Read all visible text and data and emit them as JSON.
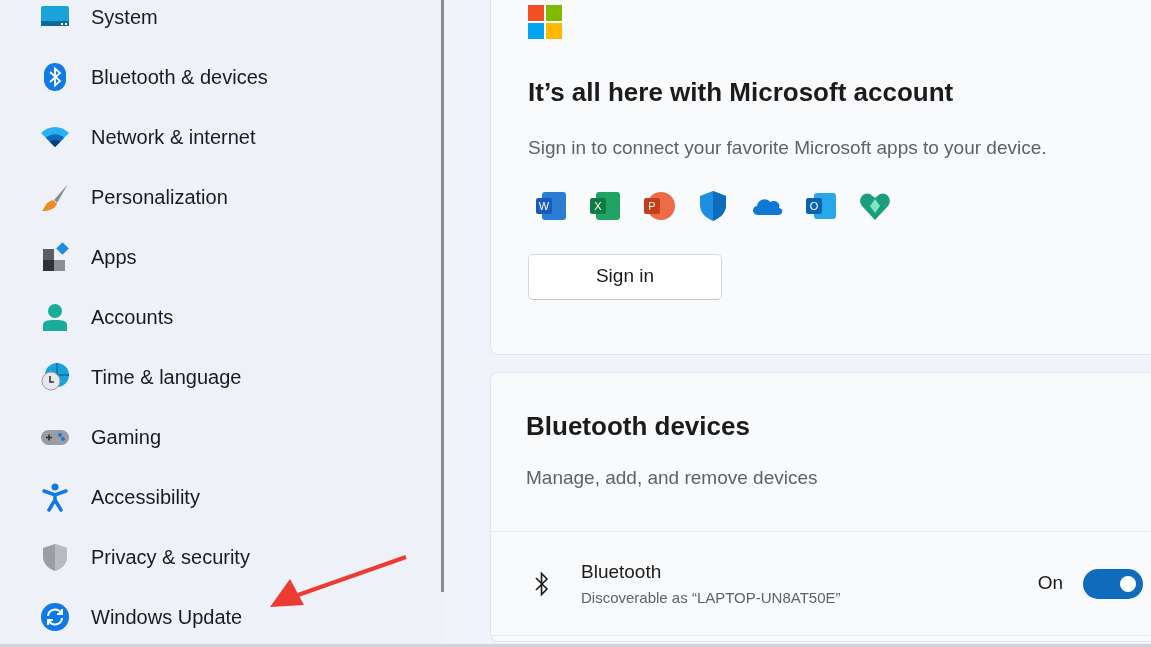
{
  "sidebar": {
    "items": [
      {
        "label": "System"
      },
      {
        "label": "Bluetooth & devices"
      },
      {
        "label": "Network & internet"
      },
      {
        "label": "Personalization"
      },
      {
        "label": "Apps"
      },
      {
        "label": "Accounts"
      },
      {
        "label": "Time & language"
      },
      {
        "label": "Gaming"
      },
      {
        "label": "Accessibility"
      },
      {
        "label": "Privacy & security"
      },
      {
        "label": "Windows Update"
      }
    ]
  },
  "account_card": {
    "title": "It’s all here with Microsoft account",
    "subtitle": "Sign in to connect your favorite Microsoft apps to your device.",
    "app_icons": [
      {
        "kind": "lettered",
        "letter": "W"
      },
      {
        "kind": "lettered",
        "letter": "X"
      },
      {
        "kind": "lettered",
        "letter": "P"
      },
      {
        "kind": "plain"
      },
      {
        "kind": "plain"
      },
      {
        "kind": "lettered",
        "letter": "O"
      },
      {
        "kind": "plain"
      }
    ],
    "button": "Sign in"
  },
  "bluetooth_card": {
    "title": "Bluetooth devices",
    "subtitle": "Manage, add, and remove devices",
    "setting": {
      "title": "Bluetooth",
      "subtitle": "Discoverable as “LAPTOP-UN8AT50E”",
      "state_label": "On",
      "on": true
    }
  }
}
